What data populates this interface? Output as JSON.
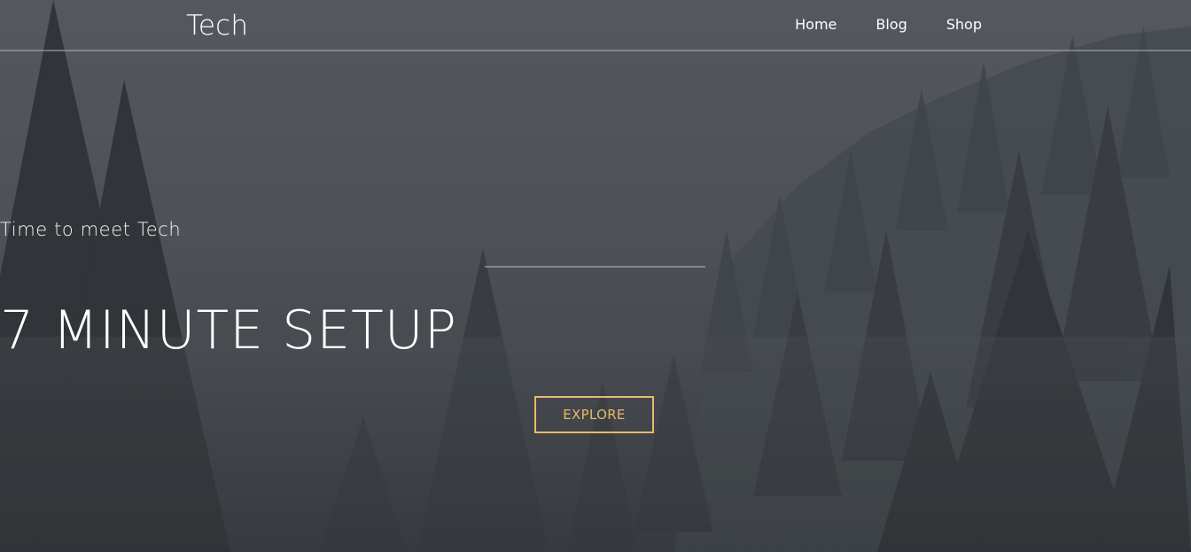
{
  "header": {
    "brand": "Tech",
    "nav": [
      {
        "label": "Home"
      },
      {
        "label": "Blog"
      },
      {
        "label": "Shop"
      }
    ]
  },
  "hero": {
    "subtitle": "Time to meet Tech",
    "headline": "7 MINUTE SETUP",
    "cta_label": "EXPLORE"
  },
  "colors": {
    "accent": "#e7b96a",
    "overlay": "#4a4e53",
    "text": "#ffffff"
  }
}
